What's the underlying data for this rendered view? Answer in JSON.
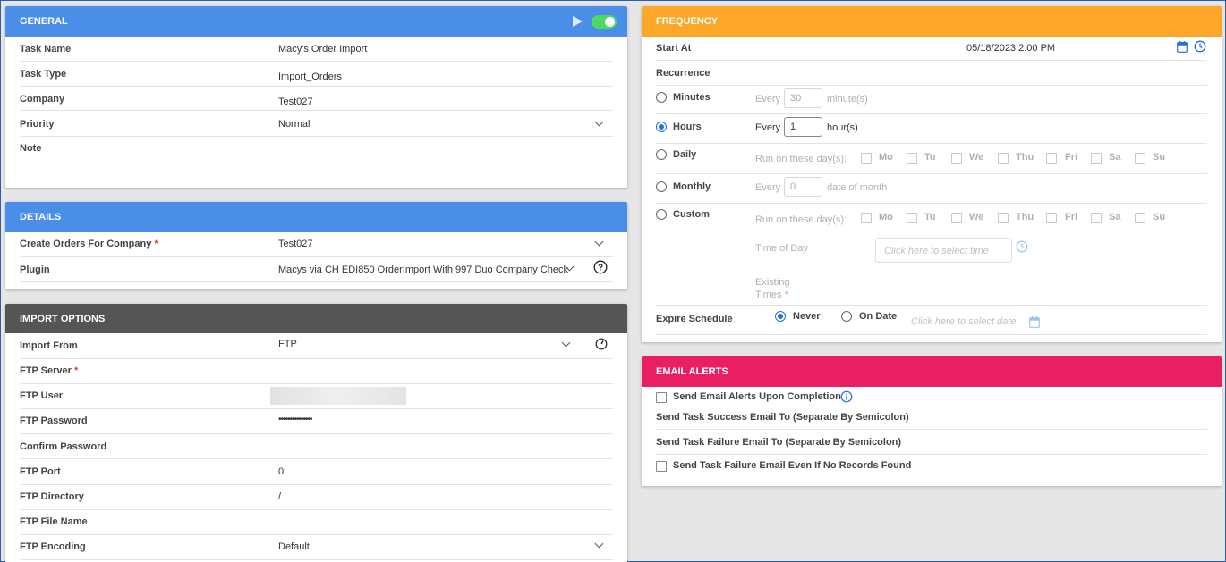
{
  "general": {
    "header": "GENERAL",
    "fields": [
      {
        "label": "Task Name",
        "value": "Macy's Order Import"
      },
      {
        "label": "Task Type",
        "value": "Import_Orders"
      },
      {
        "label": "Company",
        "value": "Test027"
      },
      {
        "label": "Priority",
        "value": "Normal"
      },
      {
        "label": "Note",
        "value": ""
      }
    ]
  },
  "details": {
    "header": "DETAILS",
    "fields": [
      {
        "label": "Create Orders For Company",
        "value": "Test027"
      },
      {
        "label": "Plugin",
        "value": "Macys via CH EDI850 OrderImport With 997 Duo Company Check"
      }
    ]
  },
  "import_options": {
    "header": "IMPORT OPTIONS",
    "fields": [
      {
        "label": "Import From",
        "value": "FTP"
      },
      {
        "label": "FTP Server",
        "value": ""
      },
      {
        "label": "FTP User",
        "value": ""
      },
      {
        "label": "FTP Password",
        "value": "•••••••••••••••"
      },
      {
        "label": "Confirm Password",
        "value": ""
      },
      {
        "label": "FTP Port",
        "value": "0"
      },
      {
        "label": "FTP Directory",
        "value": "/"
      },
      {
        "label": "FTP File Name",
        "value": ""
      },
      {
        "label": "FTP Encoding",
        "value": "Default"
      }
    ]
  },
  "frequency": {
    "header": "FREQUENCY",
    "start_at_label": "Start At",
    "start_at_value": "05/18/2023 2:00 PM",
    "recurrence_label": "Recurrence",
    "minutes": {
      "label": "Minutes",
      "every": "Every",
      "value": "30",
      "unit": "minute(s)"
    },
    "hours": {
      "label": "Hours",
      "every": "Every",
      "value": "1",
      "unit": "hour(s)"
    },
    "daily": {
      "label": "Daily",
      "run_on": "Run on these day(s):"
    },
    "monthly": {
      "label": "Monthly",
      "every": "Every",
      "value": "0",
      "unit": "date of month"
    },
    "custom": {
      "label": "Custom",
      "run_on": "Run on these day(s):",
      "time_of_day": "Time of Day",
      "time_placeholder": "Click here to select time",
      "existing_times": "Existing",
      "existing_times2": "Times"
    },
    "days": [
      "Mo",
      "Tu",
      "We",
      "Thu",
      "Fri",
      "Sa",
      "Su"
    ],
    "expire": {
      "label": "Expire Schedule",
      "never": "Never",
      "on_date": "On Date",
      "date_placeholder": "Click here to select date"
    }
  },
  "email_alerts": {
    "header": "EMAIL ALERTS",
    "send_on_completion": "Send Email Alerts Upon Completion",
    "success_email": "Send Task Success Email To (Separate By Semicolon)",
    "failure_email": "Send Task Failure Email To (Separate By Semicolon)",
    "failure_no_records": "Send Task Failure Email Even If No Records Found"
  },
  "colors": {
    "general_header": "#4a8ee8",
    "details_header": "#4a8ee8",
    "import_header": "#555555",
    "frequency_header": "#fda729",
    "email_header": "#e91e63",
    "toggle_on": "#4cd964",
    "accent_blue": "#1e6fd9"
  },
  "icons": {
    "run": "play-icon",
    "toggle": "toggle-switch",
    "help": "question-circle-icon",
    "info": "info-circle-icon",
    "calendar": "calendar-icon",
    "clock": "clock-icon"
  }
}
